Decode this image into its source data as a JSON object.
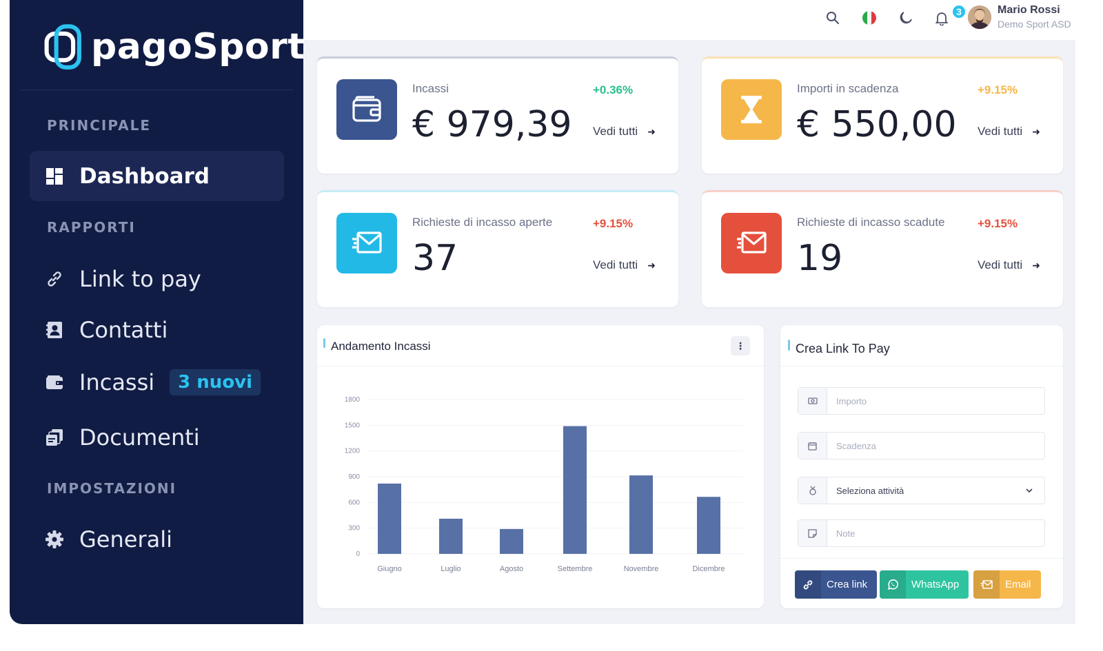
{
  "brand": {
    "name": "pagoSport"
  },
  "sidebar": {
    "sections": [
      "PRINCIPALE",
      "RAPPORTI",
      "IMPOSTAZIONI"
    ],
    "items": [
      {
        "label": "Dashboard",
        "icon": "dashboard-icon"
      },
      {
        "label": "Link to pay",
        "icon": "link-icon"
      },
      {
        "label": "Contatti",
        "icon": "contacts-icon"
      },
      {
        "label": "Incassi",
        "icon": "wallet-icon",
        "badge": "3 nuovi"
      },
      {
        "label": "Documenti",
        "icon": "documents-icon"
      },
      {
        "label": "Generali",
        "icon": "gear-icon"
      }
    ]
  },
  "topbar": {
    "notifications_count": "3",
    "user_name": "Mario Rossi",
    "user_org": "Demo Sport ASD"
  },
  "stats": [
    {
      "title": "Incassi",
      "value": "€ 979,39",
      "delta": "+0.36%",
      "link": "Vedi tutti",
      "color": "#3a5590",
      "delta_color": "#2bbf8a"
    },
    {
      "title": "Importi in scadenza",
      "value": "€ 550,00",
      "delta": "+9.15%",
      "link": "Vedi tutti",
      "color": "#f5b74a",
      "delta_color": "#f5b74a"
    },
    {
      "title": "Richieste di incasso aperte",
      "value": "37",
      "delta": "+9.15%",
      "link": "Vedi tutti",
      "color": "#22b9e6",
      "delta_color": "#e5503c"
    },
    {
      "title": "Richieste di incasso scadute",
      "value": "19",
      "delta": "+9.15%",
      "link": "Vedi tutti",
      "color": "#e5503c",
      "delta_color": "#e5503c"
    }
  ],
  "chart_card": {
    "title": "Andamento Incassi"
  },
  "chart_data": {
    "type": "bar",
    "categories": [
      "Giugno",
      "Luglio",
      "Agosto",
      "Settembre",
      "Novembre",
      "Dicembre"
    ],
    "values": [
      820,
      410,
      290,
      1490,
      915,
      665
    ],
    "yticks": [
      0,
      300,
      600,
      900,
      1200,
      1500,
      1800
    ],
    "ylim": [
      0,
      1800
    ],
    "color": "#5770a6",
    "grid": true
  },
  "form": {
    "title": "Crea Link To Pay",
    "importo_placeholder": "Importo",
    "scadenza_placeholder": "Scadenza",
    "attivita_value": "Seleziona attività",
    "note_placeholder": "Note",
    "btn_crea": "Crea link",
    "btn_whatsapp": "WhatsApp",
    "btn_email": "Email"
  }
}
